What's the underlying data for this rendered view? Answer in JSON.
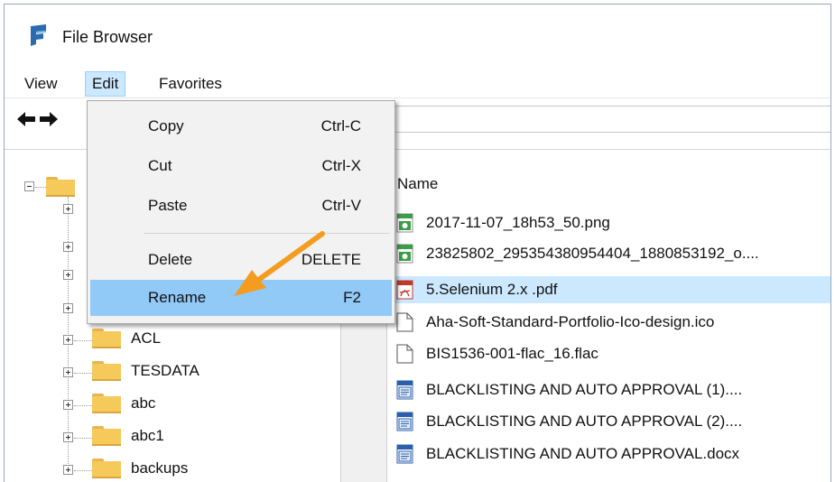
{
  "window": {
    "title": "File Browser"
  },
  "menubar": {
    "items": [
      "View",
      "Edit",
      "Favorites"
    ],
    "open_menu": "Edit"
  },
  "edit_menu": {
    "items": [
      {
        "label": "Copy",
        "shortcut": "Ctrl-C"
      },
      {
        "label": "Cut",
        "shortcut": "Ctrl-X"
      },
      {
        "label": "Paste",
        "shortcut": "Ctrl-V"
      },
      {
        "label": "Delete",
        "shortcut": "DELETE"
      },
      {
        "label": "Rename",
        "shortcut": "F2",
        "highlighted": true
      }
    ]
  },
  "tree": {
    "folders": [
      "ACL",
      "TESDATA",
      "abc",
      "abc1",
      "backups"
    ]
  },
  "filelist": {
    "column_header": "Name",
    "files": [
      {
        "name": "2017-11-07_18h53_50.png",
        "icon": "image-file-icon"
      },
      {
        "name": "23825802_295354380954404_1880853192_o....",
        "icon": "image-file-icon"
      },
      {
        "name": "5.Selenium 2.x .pdf",
        "icon": "pdf-file-icon",
        "selected": true
      },
      {
        "name": "Aha-Soft-Standard-Portfolio-Ico-design.ico",
        "icon": "generic-file-icon"
      },
      {
        "name": "BIS1536-001-flac_16.flac",
        "icon": "generic-file-icon"
      },
      {
        "name": "BLACKLISTING AND AUTO APPROVAL (1)....",
        "icon": "word-document-icon"
      },
      {
        "name": "BLACKLISTING AND AUTO APPROVAL (2)....",
        "icon": "word-document-icon"
      },
      {
        "name": "BLACKLISTING AND AUTO APPROVAL.docx",
        "icon": "word-document-icon"
      }
    ]
  },
  "colors": {
    "menu_open_bg": "#cce8ff",
    "menu_highlight": "#91c9f7",
    "selection": "#cce8ff",
    "annotation_arrow": "#f39c1f"
  }
}
